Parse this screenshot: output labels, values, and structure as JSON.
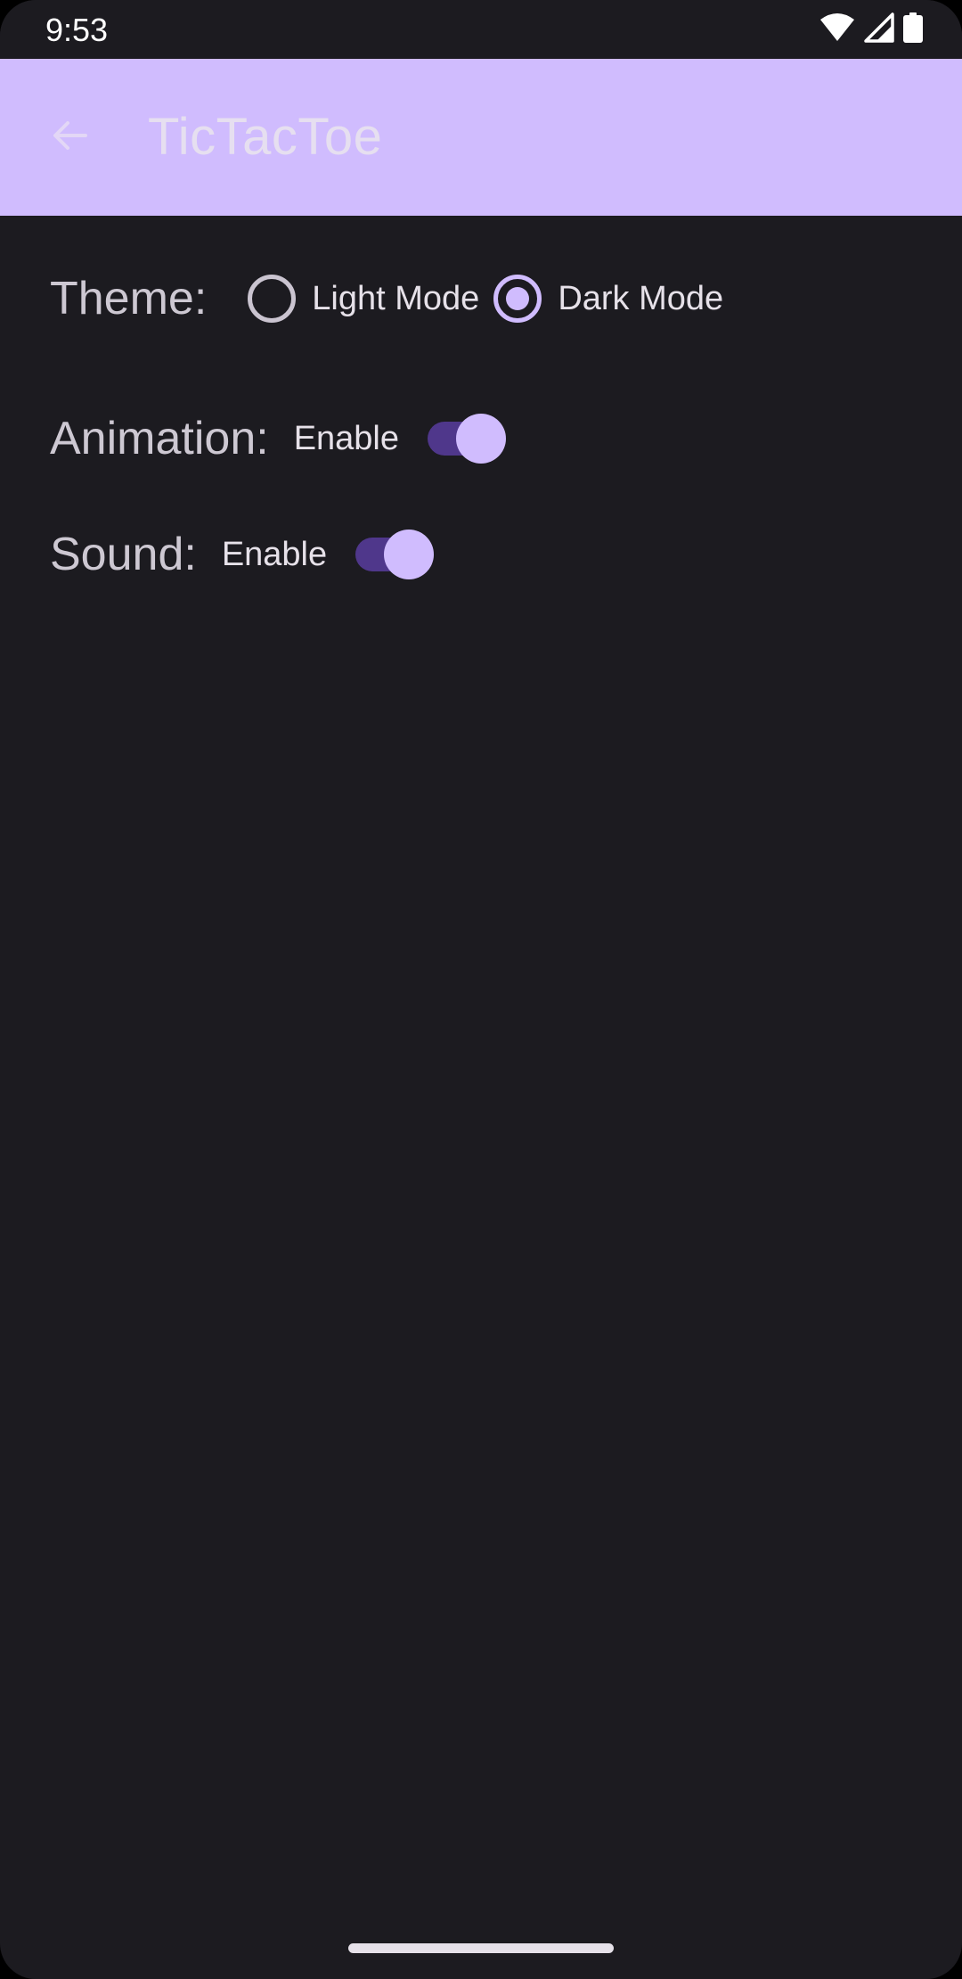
{
  "status_bar": {
    "time": "9:53",
    "icons": [
      "wifi-icon",
      "cellular-signal-icon",
      "battery-icon"
    ]
  },
  "app_bar": {
    "back_icon": "arrow-back-icon",
    "title": "TicTacToe"
  },
  "settings": {
    "theme": {
      "label": "Theme:",
      "options": [
        {
          "label": "Light Mode",
          "selected": false
        },
        {
          "label": "Dark Mode",
          "selected": true
        }
      ]
    },
    "animation": {
      "label": "Animation:",
      "switch_label": "Enable",
      "enabled": true
    },
    "sound": {
      "label": "Sound:",
      "switch_label": "Enable",
      "enabled": true
    }
  },
  "colors": {
    "background": "#1c1b20",
    "app_bar": "#d0bcfe",
    "accent": "#d0bcfe",
    "switch_track": "#4f378b",
    "label_text": "#cdc8d2"
  }
}
